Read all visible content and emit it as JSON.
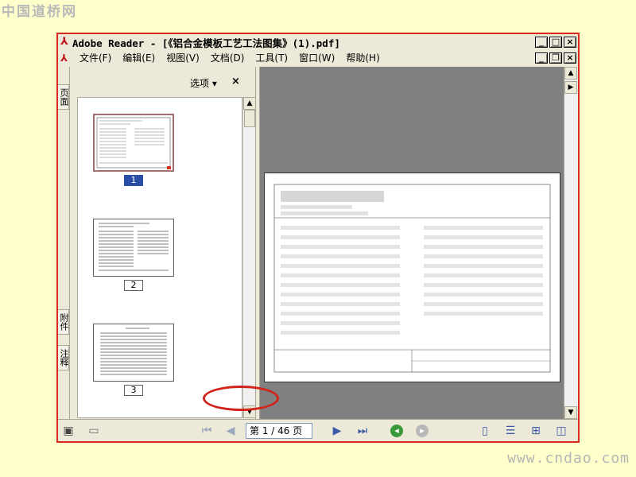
{
  "watermark_top": "中国道桥网",
  "watermark_bottom": "www.cndao.com",
  "window": {
    "title": "Adobe Reader - [《铝合金模板工艺工法图集》(1).pdf]",
    "controls": {
      "minimize": "_",
      "maximize": "□",
      "close": "×"
    }
  },
  "menu": {
    "items": [
      "文件(F)",
      "编辑(E)",
      "视图(V)",
      "文档(D)",
      "工具(T)",
      "窗口(W)",
      "帮助(H)"
    ],
    "doc_controls": {
      "minimize": "_",
      "restore": "❐",
      "close": "×"
    }
  },
  "nav_tabs": {
    "pages": "页面",
    "attachments": "附件",
    "comments": "注释"
  },
  "panel": {
    "options_label": "选项 ▾",
    "close_label": "×",
    "thumbnails": [
      {
        "number": "1",
        "selected": true
      },
      {
        "number": "2",
        "selected": false
      },
      {
        "number": "3",
        "selected": false
      }
    ]
  },
  "toolbar": {
    "page_display": "第 1 / 46 页",
    "current_page": 1,
    "total_pages": 46
  },
  "icons": {
    "first_page": "first-page-icon",
    "prev_page": "prev-page-icon",
    "next_page": "next-page-icon",
    "last_page": "last-page-icon",
    "go_back": "go-back-icon",
    "go_forward": "go-forward-icon",
    "single_page": "single-page-icon",
    "continuous": "continuous-icon",
    "continuous_facing": "continuous-facing-icon",
    "facing": "facing-icon"
  },
  "colors": {
    "frame": "#d72b1e",
    "highlight": "#d2231c",
    "doc_background": "#808080",
    "selection": "#2a4ea5",
    "go_back": "#3a9a3a"
  }
}
